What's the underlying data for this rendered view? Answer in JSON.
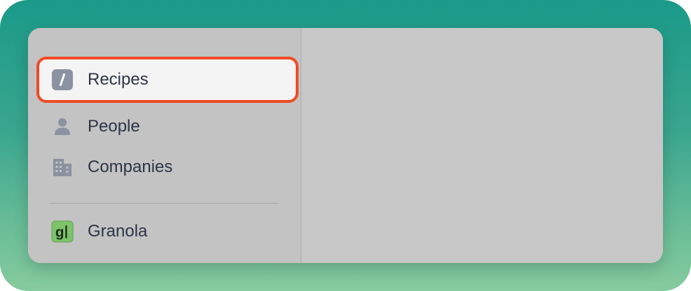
{
  "sidebar": {
    "items": [
      {
        "label": "Recipes",
        "icon": "slash-command-icon",
        "selected": true
      },
      {
        "label": "People",
        "icon": "person-icon",
        "selected": false
      },
      {
        "label": "Companies",
        "icon": "building-icon",
        "selected": false
      }
    ],
    "extensions": [
      {
        "label": "Granola",
        "icon": "granola-app-icon",
        "icon_letter": "g"
      }
    ]
  },
  "colors": {
    "highlight_outline": "#f04a23",
    "icon_gray": "#8b92a1",
    "granola_green": "#7cc36a"
  }
}
